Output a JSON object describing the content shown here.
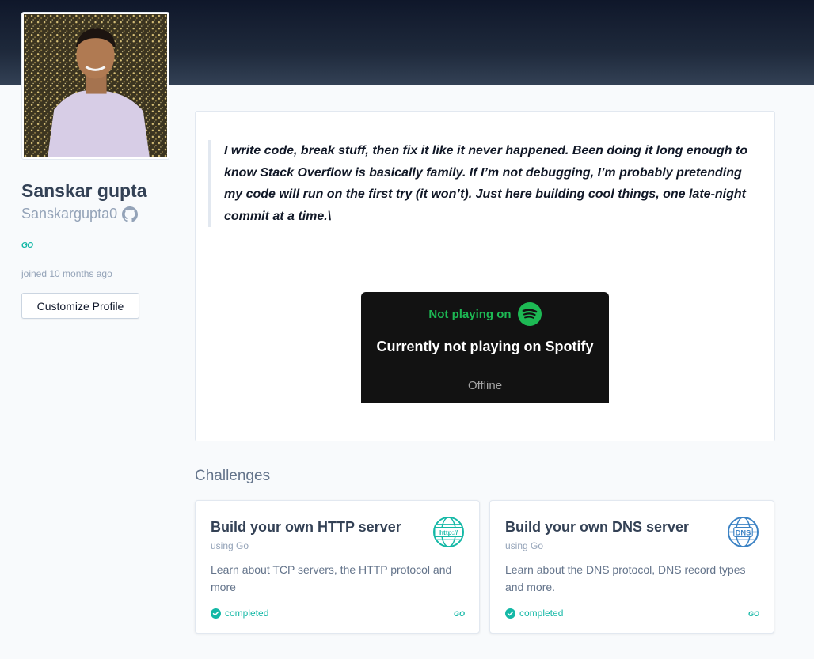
{
  "profile": {
    "name": "Sanskar gupta",
    "username": "Sanskargupta0",
    "language_badge": "GO",
    "joined": "joined 10 months ago",
    "customize_label": "Customize Profile"
  },
  "bio": {
    "text": "I write code, break stuff, then fix it like it never happened. Been doing it long enough to know Stack Overflow is basically family. If I’m not debugging, I’m probably pretending my code will run on the first try (it won’t). Just here building cool things, one late-night commit at a time.\\"
  },
  "spotify": {
    "status": "Not playing on",
    "title": "Currently not playing on Spotify",
    "subtitle": "Offline",
    "accent": "#1db954"
  },
  "challenges": {
    "heading": "Challenges",
    "items": [
      {
        "title": "Build your own HTTP server",
        "language": "using Go",
        "description": "Learn about TCP servers, the HTTP protocol and more",
        "status": "completed",
        "icon": "http-globe-icon",
        "icon_text": "http://",
        "lang_badge": "GO"
      },
      {
        "title": "Build your own DNS server",
        "language": "using Go",
        "description": "Learn about the DNS protocol, DNS record types and more.",
        "status": "completed",
        "icon": "dns-globe-icon",
        "icon_text": "DNS",
        "lang_badge": "GO"
      }
    ]
  },
  "colors": {
    "accent": "#14b8a6",
    "banner": "#1e293b"
  }
}
